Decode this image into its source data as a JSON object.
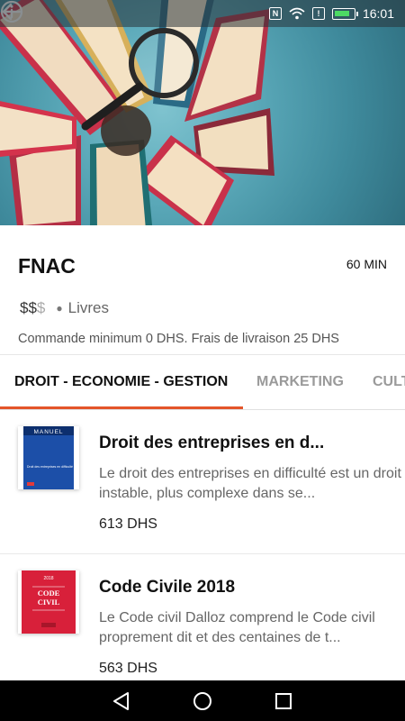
{
  "status_bar": {
    "time": "16:01",
    "icons": [
      "nfc-icon",
      "wifi-icon",
      "vibrate-icon",
      "battery-icon"
    ]
  },
  "hero": {
    "image": "books-with-magnifying-glass"
  },
  "store": {
    "name": "FNAC",
    "delivery_time": "60 MIN",
    "price_level_active": "$$",
    "price_level_inactive": "$",
    "category": "Livres",
    "min_order": "Commande minimum 0 DHS. Frais de livraison 25 DHS"
  },
  "tabs": [
    {
      "label": "DROIT - ECONOMIE - GESTION",
      "active": true
    },
    {
      "label": "MARKETING",
      "active": false
    },
    {
      "label": "CULT",
      "active": false
    }
  ],
  "products": [
    {
      "title": "Droit des entreprises en d...",
      "description": "Le droit des entreprises en difficulté est un droit instable, plus complexe dans se...",
      "price": "613 DHS",
      "thumb_title": "MANUEL",
      "thumb_subtitle": "Droit des entreprises en difficulté"
    },
    {
      "title": "Code Civile 2018",
      "description": "Le Code civil Dalloz comprend le Code civil proprement dit et des centaines de t...",
      "price": "563 DHS",
      "thumb_year": "2018",
      "thumb_title_1": "CODE",
      "thumb_title_2": "CIVIL"
    }
  ],
  "colors": {
    "accent": "#e4552a",
    "navbar": "#000000"
  }
}
